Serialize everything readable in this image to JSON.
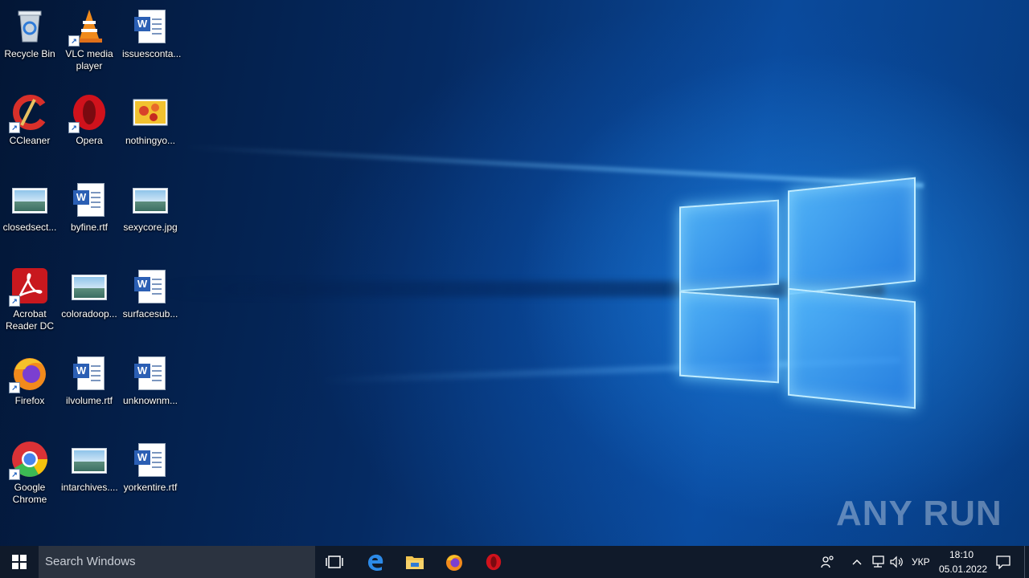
{
  "desktop": {
    "icons": [
      {
        "id": "recycle-bin",
        "label": "Recycle Bin",
        "type": "recycle"
      },
      {
        "id": "vlc",
        "label": "VLC media player",
        "type": "vlc"
      },
      {
        "id": "issuescontact",
        "label": "issuesconta...",
        "type": "word"
      },
      {
        "id": "ccleaner",
        "label": "CCleaner",
        "type": "ccleaner"
      },
      {
        "id": "opera",
        "label": "Opera",
        "type": "opera"
      },
      {
        "id": "nothingyou",
        "label": "nothingyo...",
        "type": "flowers"
      },
      {
        "id": "closedsect",
        "label": "closedsect...",
        "type": "picture"
      },
      {
        "id": "byfine",
        "label": "byfine.rtf",
        "type": "word"
      },
      {
        "id": "sexycore",
        "label": "sexycore.jpg",
        "type": "picture"
      },
      {
        "id": "acrobat",
        "label": "Acrobat Reader DC",
        "type": "acrobat"
      },
      {
        "id": "coloradoop",
        "label": "coloradoop...",
        "type": "picture"
      },
      {
        "id": "surfacesub",
        "label": "surfacesub...",
        "type": "word"
      },
      {
        "id": "firefox",
        "label": "Firefox",
        "type": "firefox"
      },
      {
        "id": "ilvolume",
        "label": "ilvolume.rtf",
        "type": "word"
      },
      {
        "id": "unknownm",
        "label": "unknownm...",
        "type": "word"
      },
      {
        "id": "chrome",
        "label": "Google Chrome",
        "type": "chrome"
      },
      {
        "id": "intarchives",
        "label": "intarchives....",
        "type": "picture"
      },
      {
        "id": "yorkentire",
        "label": "yorkentire.rtf",
        "type": "word"
      }
    ],
    "watermark": "ANY RUN"
  },
  "taskbar": {
    "search_placeholder": "Search Windows",
    "pinned": [
      "task-view",
      "edge",
      "file-explorer",
      "firefox",
      "opera"
    ],
    "tray": {
      "language": "УКР",
      "time": "18:10",
      "date": "05.01.2022"
    }
  },
  "colors": {
    "taskbar": "#101a2a",
    "search_box": "#2b3340",
    "accent": "#0a4a9c"
  }
}
